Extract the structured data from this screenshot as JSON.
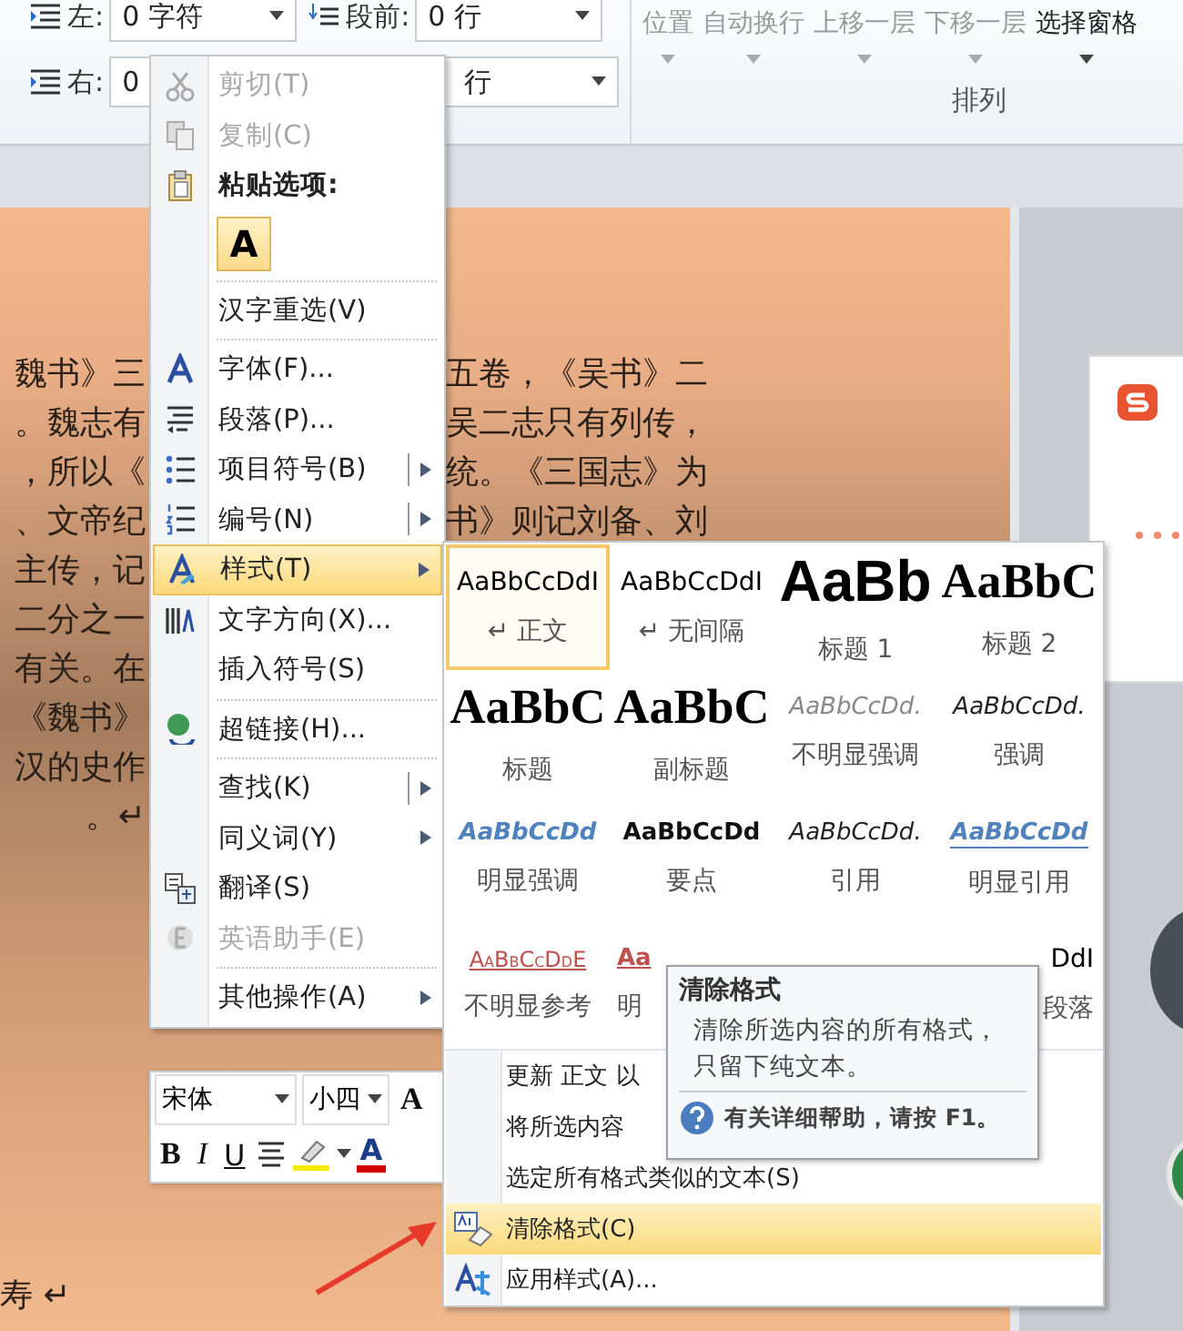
{
  "ribbon": {
    "indent": [
      {
        "label": "左:",
        "value": "0 字符"
      },
      {
        "label": "右:",
        "value": "0"
      }
    ],
    "spacing": [
      {
        "label": "段前:",
        "value": "0 行"
      },
      {
        "value": "行"
      }
    ],
    "arrange": {
      "buttons": [
        {
          "label": "位置",
          "disabled": true
        },
        {
          "label": "自动换行",
          "disabled": true
        },
        {
          "label": "上移一层",
          "disabled": true
        },
        {
          "label": "下移一层",
          "disabled": true
        },
        {
          "label": "选择窗格",
          "disabled": false
        }
      ],
      "group_label": "排列"
    }
  },
  "document": {
    "left_lines": [
      "魏书》三",
      "。魏志有",
      "，所以《",
      "、文帝纪",
      "主传，记",
      "二分之一",
      "有关。在",
      "《魏书》",
      "汉的史作",
      "。↵"
    ],
    "right_lines": [
      "五卷，《吴书》二",
      "吴二志只有列传，",
      "统。《三国志》为",
      "书》则记刘备、刘"
    ],
    "last_line": "寿 ↵"
  },
  "context_menu": [
    {
      "kind": "item",
      "label": "剪切(T)",
      "disabled": true,
      "selected": false,
      "submenu": false
    },
    {
      "kind": "item",
      "label": "复制(C)",
      "disabled": true,
      "selected": false,
      "submenu": false
    },
    {
      "kind": "header",
      "label": "粘贴选项:"
    },
    {
      "kind": "paste",
      "label": "A"
    },
    {
      "kind": "separator"
    },
    {
      "kind": "item",
      "label": "汉字重选(V)",
      "disabled": false,
      "selected": false,
      "submenu": false
    },
    {
      "kind": "separator"
    },
    {
      "kind": "item",
      "label": "字体(F)...",
      "disabled": false,
      "selected": false,
      "submenu": false
    },
    {
      "kind": "item",
      "label": "段落(P)...",
      "disabled": false,
      "selected": false,
      "submenu": false
    },
    {
      "kind": "item",
      "label": "项目符号(B)",
      "disabled": false,
      "selected": false,
      "submenu": true,
      "split": true
    },
    {
      "kind": "item",
      "label": "编号(N)",
      "disabled": false,
      "selected": false,
      "submenu": true,
      "split": true
    },
    {
      "kind": "item",
      "label": "样式(T)",
      "disabled": false,
      "selected": true,
      "submenu": true,
      "split": false
    },
    {
      "kind": "item",
      "label": "文字方向(X)...",
      "disabled": false,
      "selected": false,
      "submenu": false
    },
    {
      "kind": "item",
      "label": "插入符号(S)",
      "disabled": false,
      "selected": false,
      "submenu": false
    },
    {
      "kind": "separator"
    },
    {
      "kind": "item",
      "label": "超链接(H)...",
      "disabled": false,
      "selected": false,
      "submenu": false
    },
    {
      "kind": "separator"
    },
    {
      "kind": "item",
      "label": "查找(K)",
      "disabled": false,
      "selected": false,
      "submenu": true,
      "split": true
    },
    {
      "kind": "item",
      "label": "同义词(Y)",
      "disabled": false,
      "selected": false,
      "submenu": true,
      "split": false
    },
    {
      "kind": "item",
      "label": "翻译(S)",
      "disabled": false,
      "selected": false,
      "submenu": false
    },
    {
      "kind": "item",
      "label": "英语助手(E)",
      "disabled": true,
      "selected": false,
      "submenu": false
    },
    {
      "kind": "separator"
    },
    {
      "kind": "item",
      "label": "其他操作(A)",
      "disabled": false,
      "selected": false,
      "submenu": true,
      "split": false
    }
  ],
  "mini_toolbar": {
    "font": "宋体",
    "size": "小四",
    "grow": "A",
    "bold": "B",
    "italic": "I",
    "underline": "U",
    "font_color": "A"
  },
  "styles_menu": {
    "gallery": [
      {
        "sample": "AaBbCcDdI",
        "label": "↵ 正文",
        "selected": true
      },
      {
        "sample": "AaBbCcDdI",
        "label": "↵ 无间隔",
        "selected": false
      },
      {
        "sample": "AaBb",
        "label": "标题 1",
        "selected": false
      },
      {
        "sample": "AaBbC",
        "label": "标题 2",
        "selected": false
      },
      {
        "sample": "AaBbC",
        "label": "标题",
        "selected": false
      },
      {
        "sample": "AaBbC",
        "label": "副标题",
        "selected": false
      },
      {
        "sample": "AaBbCcDd.",
        "label": "不明显强调",
        "selected": false
      },
      {
        "sample": "AaBbCcDd.",
        "label": "强调",
        "selected": false
      },
      {
        "sample": "AaBbCcDd",
        "label": "明显强调",
        "selected": false
      },
      {
        "sample": "AaBbCcDd",
        "label": "要点",
        "selected": false
      },
      {
        "sample": "AaBbCcDd.",
        "label": "引用",
        "selected": false
      },
      {
        "sample": "AaBbCcDd",
        "label": "明显引用",
        "selected": false
      },
      {
        "sample": "AaBbCcDdE",
        "label": "不明显参考",
        "selected": false
      },
      {
        "sample": "Aa",
        "label": "明",
        "selected": false
      },
      {
        "selected": false
      },
      {
        "sample": "DdI",
        "label": "段落",
        "selected": false
      }
    ],
    "items": [
      {
        "label": "更新 正文 以",
        "selected": false
      },
      {
        "label": "将所选内容",
        "selected": false
      },
      {
        "label": "选定所有格式类似的文本(S)",
        "selected": false
      },
      {
        "label": "清除格式(C)",
        "selected": true
      },
      {
        "label": "应用样式(A)...",
        "selected": false
      }
    ]
  },
  "tooltip": {
    "title": "清除格式",
    "text": "清除所选内容的所有格式，只留下纯文本。",
    "help": "有关详细帮助，请按 F1。"
  }
}
